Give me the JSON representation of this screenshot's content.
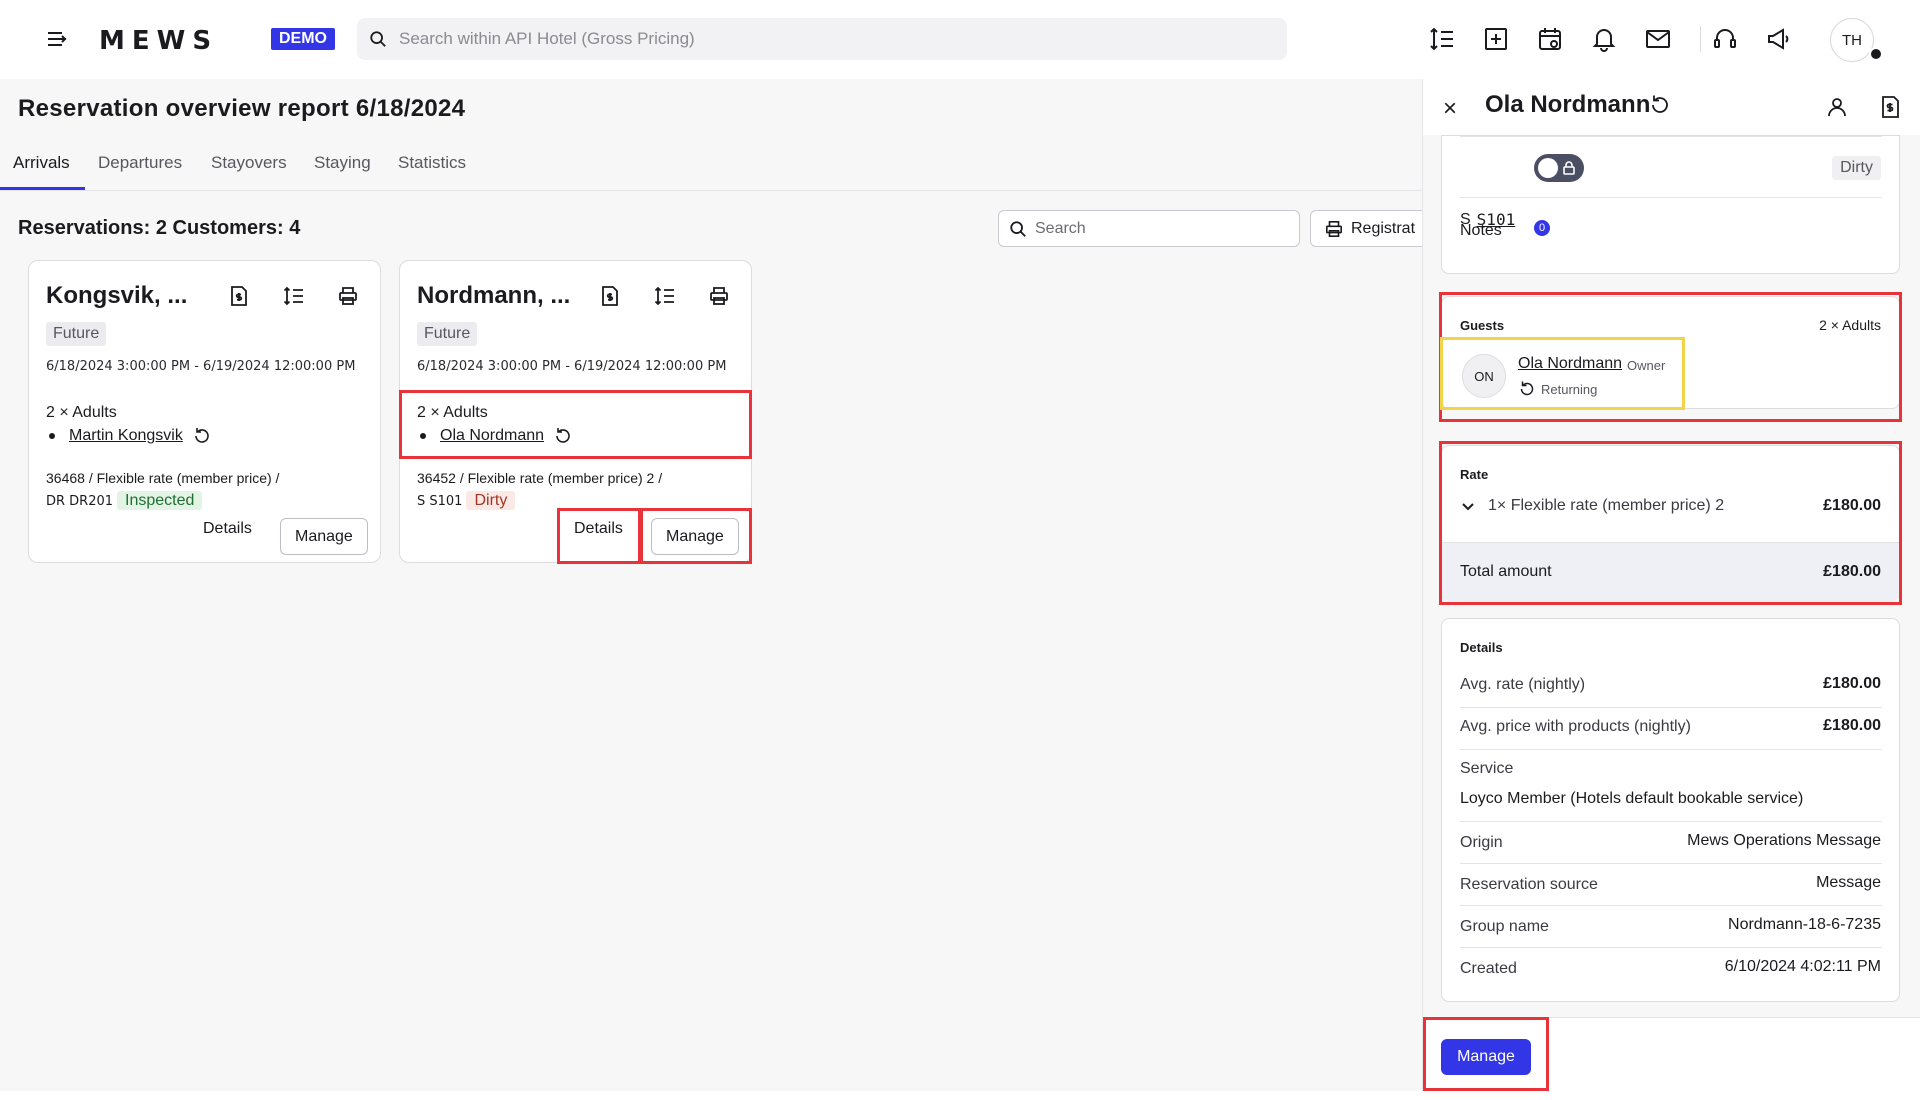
{
  "topbar": {
    "logo": "MEWS",
    "env_badge": "DEMO",
    "search_placeholder": "Search within API Hotel (Gross Pricing)",
    "avatar_initials": "TH"
  },
  "page": {
    "title": "Reservation overview report 6/18/2024",
    "tabs": [
      "Arrivals",
      "Departures",
      "Stayovers",
      "Staying",
      "Statistics"
    ],
    "active_tab": "Arrivals",
    "counts": "Reservations: 2 Customers: 4",
    "search_placeholder": "Search",
    "registration_label": "Registrat"
  },
  "cards": [
    {
      "title": "Kongsvik, ...",
      "status": "Future",
      "dates": "6/18/2024 3:00:00 PM - 6/19/2024 12:00:00 PM",
      "adults": "2 × Adults",
      "guest": "Martin Kongsvik",
      "rate_line": "36468 / Flexible rate (member price) /",
      "room": "DR DR201",
      "room_state": "Inspected",
      "details_label": "Details",
      "manage_label": "Manage"
    },
    {
      "title": "Nordmann, ...",
      "status": "Future",
      "dates": "6/18/2024 3:00:00 PM - 6/19/2024 12:00:00 PM",
      "adults": "2 × Adults",
      "guest": "Ola Nordmann",
      "rate_line": "36452 / Flexible rate (member price) 2 /",
      "room": "S S101",
      "room_state": "Dirty",
      "details_label": "Details",
      "manage_label": "Manage"
    }
  ],
  "panel": {
    "close": "×",
    "name": "Ola Nordmann",
    "room_prefix": "S",
    "room_number": "S101",
    "room_state": "Dirty",
    "notes_label": "Notes",
    "notes_count": "0",
    "guests": {
      "label": "Guests",
      "count": "2 × Adults",
      "initials": "ON",
      "name": "Ola Nordmann",
      "role": "Owner",
      "status": "Returning"
    },
    "rate": {
      "label": "Rate",
      "line": "1× Flexible rate (member price) 2",
      "line_amount": "£180.00",
      "total_label": "Total amount",
      "total_amount": "£180.00"
    },
    "details": {
      "label": "Details",
      "avg_rate_label": "Avg. rate (nightly)",
      "avg_rate": "£180.00",
      "avg_price_label": "Avg. price with products (nightly)",
      "avg_price": "£180.00",
      "service_label": "Service",
      "service": "Loyco Member (Hotels default bookable service)",
      "origin_label": "Origin",
      "origin": "Mews Operations Message",
      "source_label": "Reservation source",
      "source": "Message",
      "group_label": "Group name",
      "group": "Nordmann-18-6-7235",
      "created_label": "Created",
      "created": "6/10/2024 4:02:11 PM"
    },
    "manage_label": "Manage"
  }
}
